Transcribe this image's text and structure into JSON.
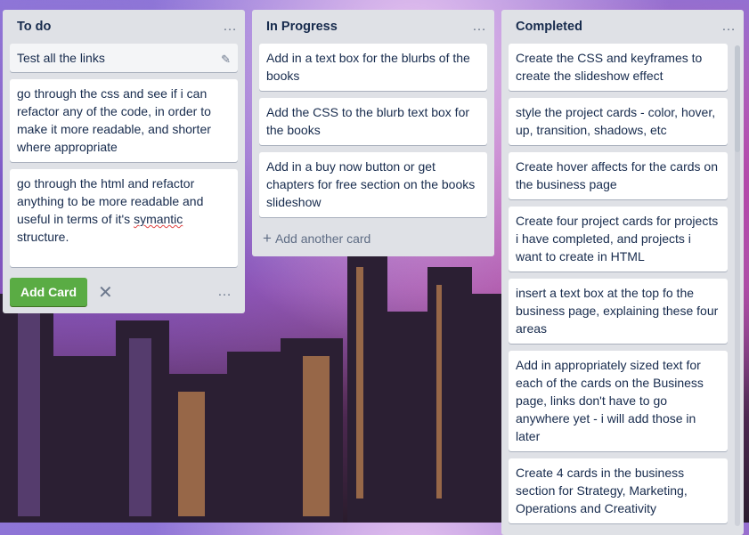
{
  "lists": [
    {
      "title": "To do",
      "cards": [
        "Test all the links",
        "go through the css and see if i can refactor any of the code, in order to make it more readable, and shorter where appropriate"
      ],
      "composer_text_before": "go through the html and refactor anything to be more readable and useful in terms of it's ",
      "composer_text_misspelled": "symantic",
      "composer_text_after": " structure.",
      "add_button": "Add Card"
    },
    {
      "title": "In Progress",
      "cards": [
        "Add in a text box for the blurbs of the books",
        "Add the CSS to the blurb text box for the books",
        "Add in a buy now button or get chapters for free section on the books slideshow"
      ],
      "add_another": "Add another card"
    },
    {
      "title": "Completed",
      "cards": [
        "Create the CSS and keyframes to create the slideshow effect",
        "style the project cards - color, hover, up, transition, shadows, etc",
        "Create hover affects for the cards on the business page",
        "Create four project cards for projects i have completed, and projects i want to create in HTML",
        "insert a text box at the top fo the business page, explaining these four areas",
        "Add in appropriately sized text for each of the cards on the Business page, links don't have to go anywhere yet - i will add those in later",
        "Create 4 cards in the business section for Strategy, Marketing, Operations and Creativity"
      ]
    }
  ],
  "icons": {
    "menu": "…",
    "edit": "✎",
    "close": "✕",
    "plus": "+"
  }
}
